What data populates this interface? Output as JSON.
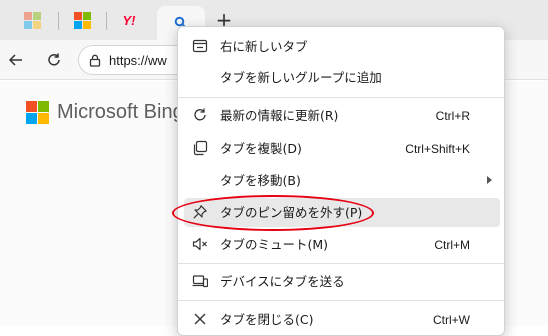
{
  "tabs": [
    {
      "icon": "microsoft-logo-icon"
    },
    {
      "icon": "microsoft-logo-icon"
    },
    {
      "icon": "yahoo-japan-icon",
      "text": "Y!"
    },
    {
      "icon": "search-icon",
      "active": true
    }
  ],
  "new_tab_label": "+",
  "address_bar": {
    "url": "https://ww"
  },
  "page": {
    "brand_text": "Microsoft Bing"
  },
  "context_menu": {
    "items": [
      {
        "label": "右に新しいタブ",
        "icon": "new-tab-right-icon",
        "shortcut": ""
      },
      {
        "label": "タブを新しいグループに追加",
        "icon": "",
        "shortcut": ""
      },
      {
        "label": "最新の情報に更新(R)",
        "icon": "refresh-icon",
        "shortcut": "Ctrl+R"
      },
      {
        "label": "タブを複製(D)",
        "icon": "duplicate-icon",
        "shortcut": "Ctrl+Shift+K"
      },
      {
        "label": "タブを移動(B)",
        "icon": "",
        "shortcut": "",
        "submenu": true
      },
      {
        "label": "タブのピン留めを外す(P)",
        "icon": "unpin-icon",
        "shortcut": "",
        "highlighted": true
      },
      {
        "label": "タブのミュート(M)",
        "icon": "mute-icon",
        "shortcut": "Ctrl+M"
      },
      {
        "label": "デバイスにタブを送る",
        "icon": "send-to-device-icon",
        "shortcut": ""
      },
      {
        "label": "タブを閉じる(C)",
        "icon": "close-icon",
        "shortcut": "Ctrl+W"
      }
    ]
  },
  "colors": {
    "annotation_red": "#e60012",
    "highlight": "#e8e8e8",
    "ms_red": "#f25022",
    "ms_green": "#7fba00",
    "ms_blue": "#00a4ef",
    "ms_yellow": "#ffb900",
    "yahoo_red": "#ff0033"
  }
}
